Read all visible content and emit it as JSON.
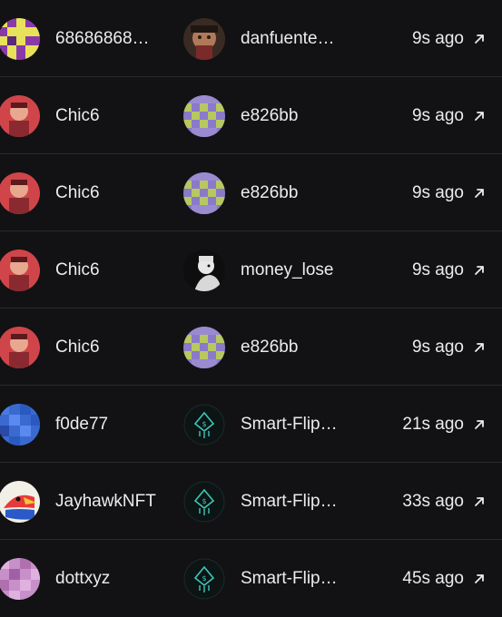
{
  "activity": {
    "rows": [
      {
        "from": "68686868…",
        "from_avatar": "pixel-yellow-purple-avatar",
        "to": "danfuente…",
        "to_avatar": "photo-avatar",
        "time": "9s ago",
        "link_icon": "arrow-up-right-icon"
      },
      {
        "from": "Chic6",
        "from_avatar": "red-illustration-avatar",
        "to": "e826bb",
        "to_avatar": "pixel-purple-green-avatar",
        "time": "9s ago",
        "link_icon": "arrow-up-right-icon"
      },
      {
        "from": "Chic6",
        "from_avatar": "red-illustration-avatar",
        "to": "e826bb",
        "to_avatar": "pixel-purple-green-avatar",
        "time": "9s ago",
        "link_icon": "arrow-up-right-icon"
      },
      {
        "from": "Chic6",
        "from_avatar": "red-illustration-avatar",
        "to": "money_lose",
        "to_avatar": "bw-illustration-avatar",
        "time": "9s ago",
        "link_icon": "arrow-up-right-icon"
      },
      {
        "from": "Chic6",
        "from_avatar": "red-illustration-avatar",
        "to": "e826bb",
        "to_avatar": "pixel-purple-green-avatar",
        "time": "9s ago",
        "link_icon": "arrow-up-right-icon"
      },
      {
        "from": "f0de77",
        "from_avatar": "pixel-blue-avatar",
        "to": "Smart-Flip…",
        "to_avatar": "smart-flip-logo-avatar",
        "time": "21s ago",
        "link_icon": "arrow-up-right-icon"
      },
      {
        "from": "JayhawkNFT",
        "from_avatar": "jayhawk-avatar",
        "to": "Smart-Flip…",
        "to_avatar": "smart-flip-logo-avatar",
        "time": "33s ago",
        "link_icon": "arrow-up-right-icon"
      },
      {
        "from": "dottxyz",
        "from_avatar": "pixel-pink-avatar",
        "to": "Smart-Flip…",
        "to_avatar": "smart-flip-logo-avatar",
        "time": "45s ago",
        "link_icon": "arrow-up-right-icon"
      }
    ]
  },
  "colors": {
    "background": "#121214",
    "divider": "#2a2a2e",
    "text": "#ececef"
  }
}
